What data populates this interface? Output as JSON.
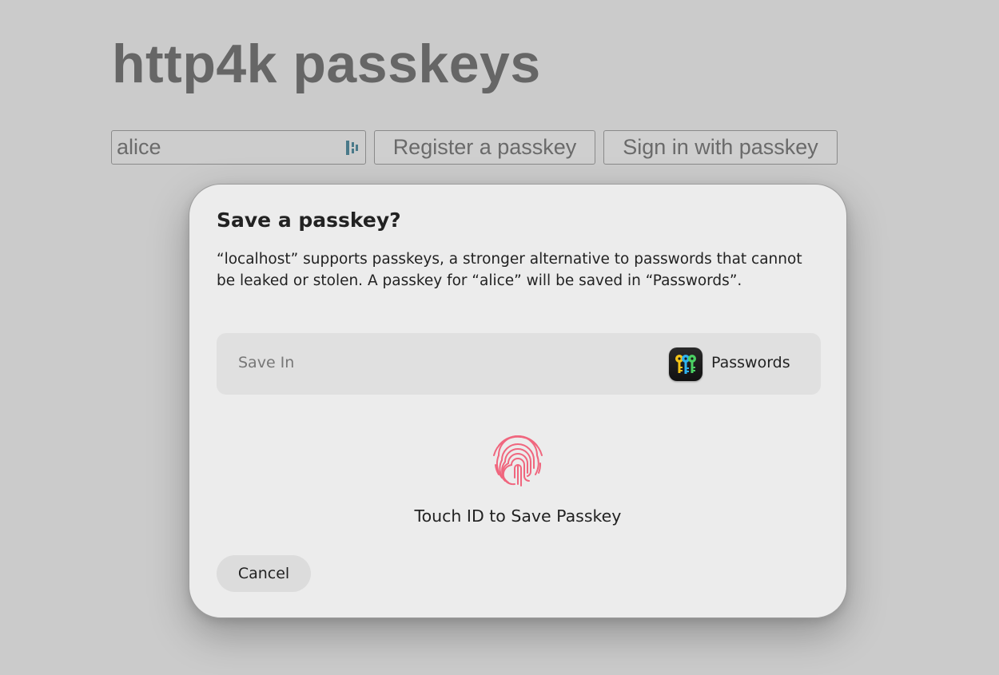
{
  "page": {
    "title": "http4k passkeys",
    "username_value": "alice",
    "register_label": "Register a passkey",
    "signin_label": "Sign in with passkey"
  },
  "dialog": {
    "title": "Save a passkey?",
    "message": "“localhost” supports passkeys, a stronger alternative to passwords that cannot be leaked or stolen. A passkey for “alice” will be saved in “Passwords”.",
    "save_in_label": "Save In",
    "save_in_app": "Passwords",
    "touch_id_label": "Touch ID to Save Passkey",
    "cancel_label": "Cancel"
  },
  "icons": {
    "password_manager": "password-manager-icon",
    "passwords_app": "passwords-app-icon",
    "fingerprint": "fingerprint-icon"
  },
  "colors": {
    "fingerprint": "#f0667e",
    "page_background": "#cbcbcb",
    "dialog_background": "#ececec"
  }
}
